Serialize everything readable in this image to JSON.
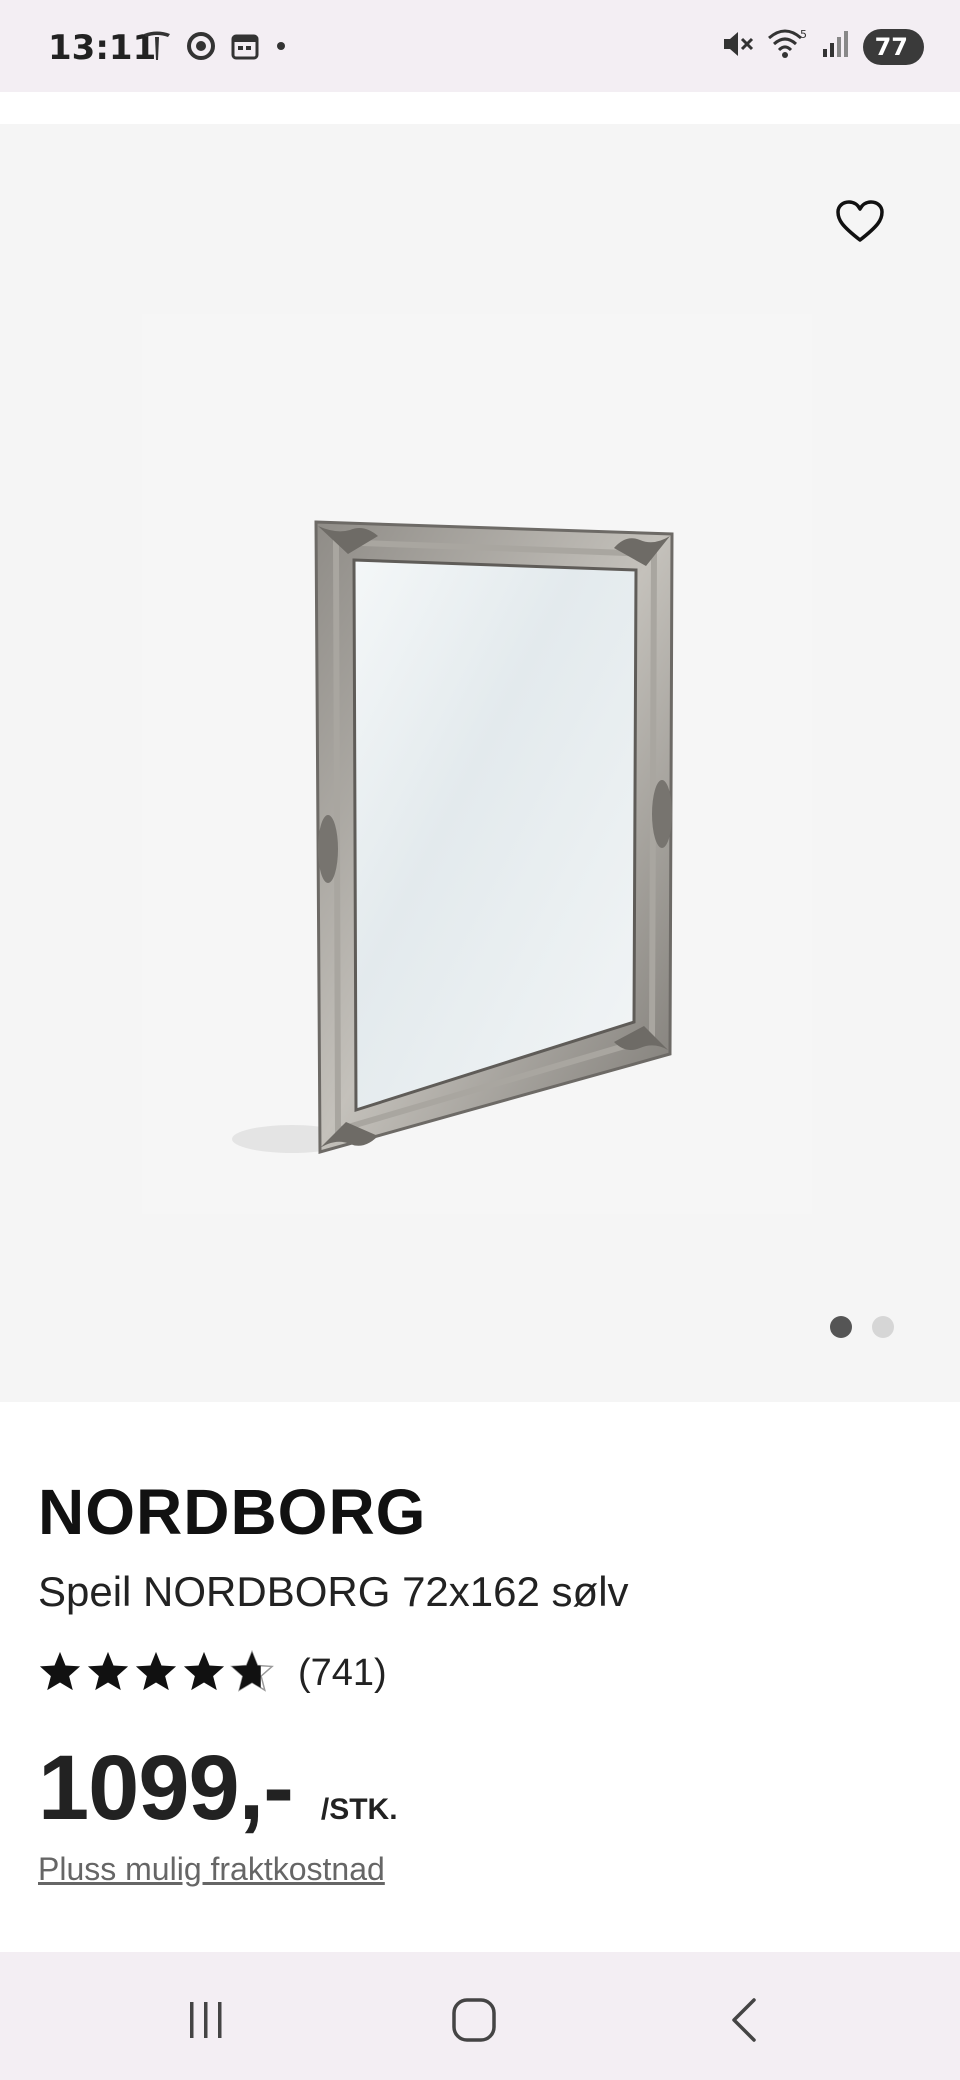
{
  "status_bar": {
    "time": "13:11",
    "battery": "77",
    "left_icons": [
      "tesla-icon",
      "chrome-icon",
      "calendar-icon",
      "dot-icon"
    ],
    "right_icons": [
      "mute-icon",
      "wifi-icon",
      "signal-icon"
    ]
  },
  "gallery": {
    "image_count": 2,
    "active_index": 0
  },
  "product": {
    "brand": "NORDBORG",
    "name": "Speil NORDBORG 72x162 sølv",
    "rating": 4.7,
    "review_count": "(741)",
    "price": "1099,-",
    "unit": "/STK.",
    "shipping_link": "Pluss mulig fraktkostnad"
  },
  "colors": {
    "status_bg": "#f3eef3",
    "gallery_bg": "#f5f5f5",
    "text": "#111111",
    "link": "#666666"
  }
}
